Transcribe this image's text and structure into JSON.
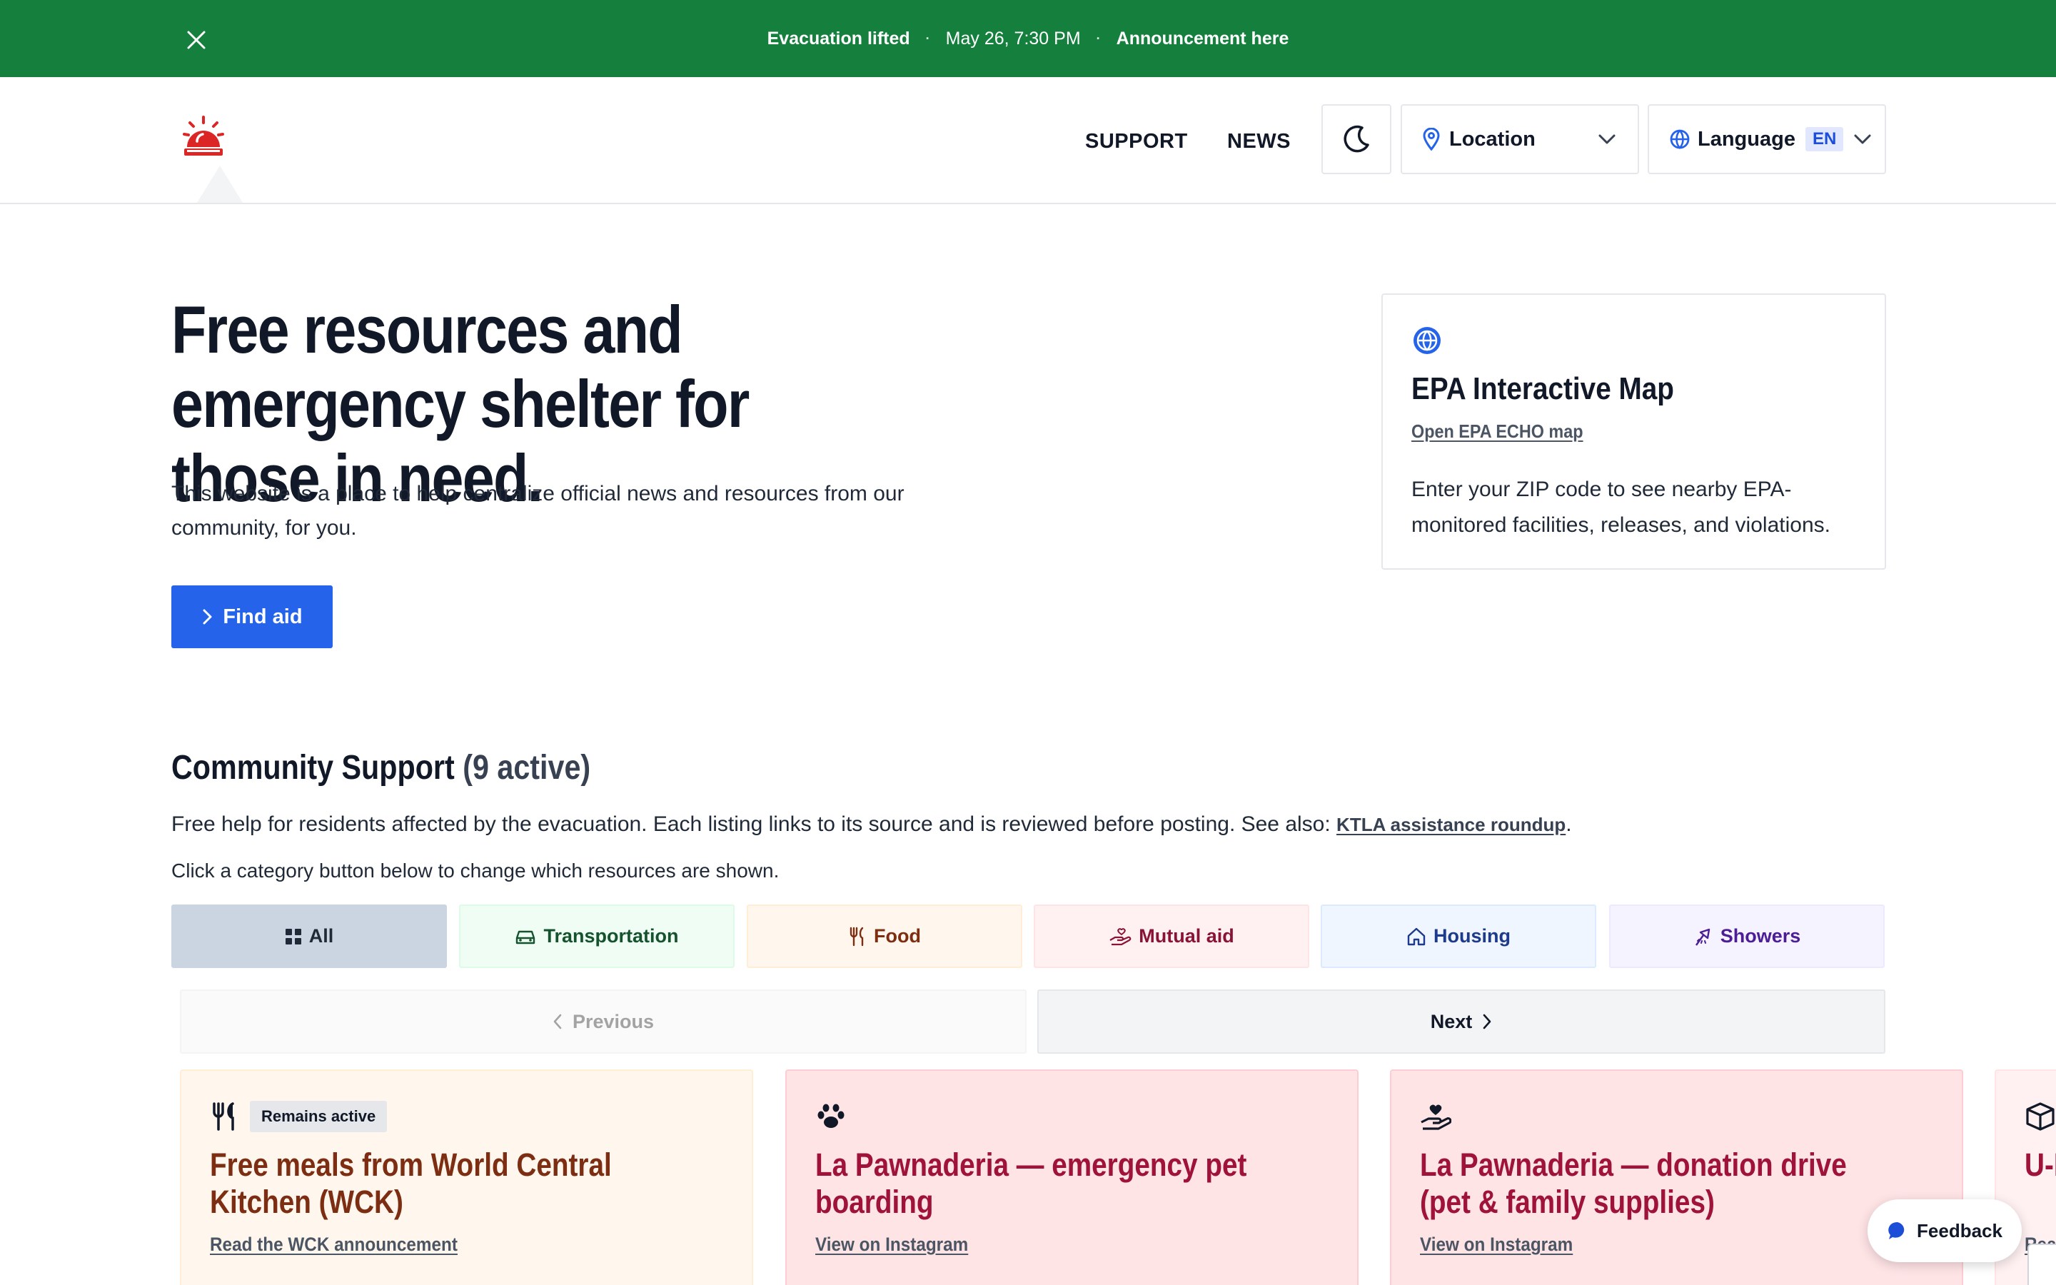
{
  "announcement": {
    "status": "Evacuation lifted",
    "date": "May 26, 7:30 PM",
    "message": "Announcement here",
    "separator": "·"
  },
  "header": {
    "nav": [
      "SUPPORT",
      "NEWS"
    ],
    "location_label": "Location",
    "language_label": "Language",
    "language_code": "EN",
    "icons": [
      "siren-logo-icon",
      "moon-icon",
      "map-pin-icon",
      "globe-icon",
      "chevron-down-icon"
    ]
  },
  "hero": {
    "title": "Free resources and emergency shelter for those in need.",
    "description": "This website is a place to help centralize official news and resources from our community, for you.",
    "cta": "Find aid"
  },
  "epa_card": {
    "title": "EPA Interactive Map",
    "link": "Open EPA ECHO map",
    "description": "Enter your ZIP code to see nearby EPA-monitored facilities, releases, and violations."
  },
  "community": {
    "title": "Community Support",
    "count": "(9 active)",
    "description": "Free help for residents affected by the evacuation. Each listing links to its source and is reviewed before posting. See also:",
    "link": "KTLA assistance roundup",
    "hint": "Click a category button below to change which resources are shown.",
    "categories": [
      "All",
      "Transportation",
      "Food",
      "Mutual aid",
      "Housing",
      "Showers"
    ],
    "pager": {
      "previous": "Previous",
      "next": "Next"
    }
  },
  "cards": [
    {
      "badge": "Remains active",
      "title": "Free meals from World Central Kitchen (WCK)",
      "link": "Read the WCK announcement",
      "icon": "fork-knife-icon"
    },
    {
      "title": "La Pawnaderia — emergency pet boarding",
      "link": "View on Instagram",
      "icon": "paw-icon"
    },
    {
      "title": "La Pawnaderia — donation drive (pet & family supplies)",
      "link": "View on Instagram",
      "icon": "hand-heart-icon"
    },
    {
      "title": "U-H",
      "link": "Rea",
      "icon": "box-icon"
    }
  ],
  "feedback_label": "Feedback",
  "colors": {
    "announcement_bg": "#15803d",
    "primary": "#2563eb",
    "logo_red": "#dc2626"
  }
}
